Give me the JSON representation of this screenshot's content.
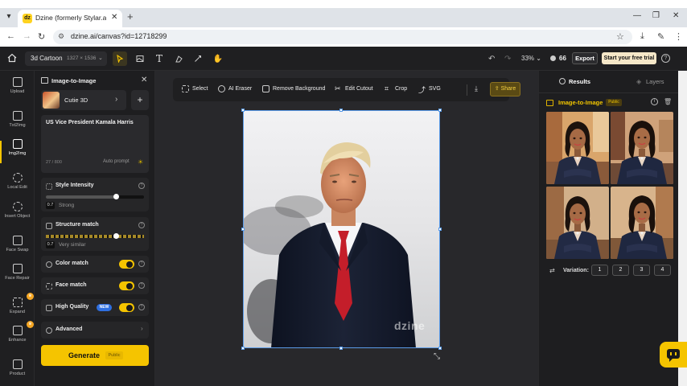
{
  "browser": {
    "tab_title": "Dzine (formerly Stylar.ai) - The",
    "favicon_text": "dz",
    "url": "dzine.ai/canvas?id=12718299"
  },
  "appbar": {
    "project_name": "3d Cartoon",
    "project_size": "1327 × 1536",
    "zoom": "33%",
    "credits": "66",
    "export_label": "Export",
    "trial_label": "Start your free trial"
  },
  "rail": {
    "items": [
      {
        "label": "Upload"
      },
      {
        "label": "Txt2Img"
      },
      {
        "label": "Img2Img"
      },
      {
        "label": "Local Edit"
      },
      {
        "label": "Insert Object"
      },
      {
        "label": "Face Swap"
      },
      {
        "label": "Face Repair"
      },
      {
        "label": "Expand"
      },
      {
        "label": "Enhance"
      },
      {
        "label": "Product"
      }
    ]
  },
  "panel": {
    "title": "Image-to-Image",
    "model_name": "Cutie 3D",
    "prompt_text": "US Vice President Kamala Harris",
    "prompt_count": "27 / 800",
    "auto_prompt": "Auto prompt",
    "style_intensity": {
      "title": "Style Intensity",
      "value": "0.7",
      "desc": "Strong",
      "fraction": 0.72
    },
    "structure_match": {
      "title": "Structure match",
      "value": "0.7",
      "desc": "Very similar",
      "fraction": 0.72
    },
    "color_match": {
      "title": "Color match",
      "on": true
    },
    "face_match": {
      "title": "Face match",
      "on": true
    },
    "high_quality": {
      "title": "High Quality",
      "badge": "NEW",
      "on": true
    },
    "advanced": "Advanced",
    "generate_label": "Generate",
    "generate_badge": "Public"
  },
  "canvas_toolbar": {
    "select": "Select",
    "ai_eraser": "AI Eraser",
    "remove_bg": "Remove Background",
    "edit_cutout": "Edit Cutout",
    "crop": "Crop",
    "svg": "SVG",
    "share": "Share"
  },
  "canvas": {
    "watermark": "dzine"
  },
  "results": {
    "tab_results": "Results",
    "tab_layers": "Layers",
    "section_title": "Image-to-Image",
    "badge": "Public",
    "variation_label": "Variation:",
    "variations": [
      "1",
      "2",
      "3",
      "4"
    ]
  },
  "colors": {
    "accent": "#f5c400",
    "app_bg": "#1e1e20",
    "canvas_bg": "#28282b"
  }
}
